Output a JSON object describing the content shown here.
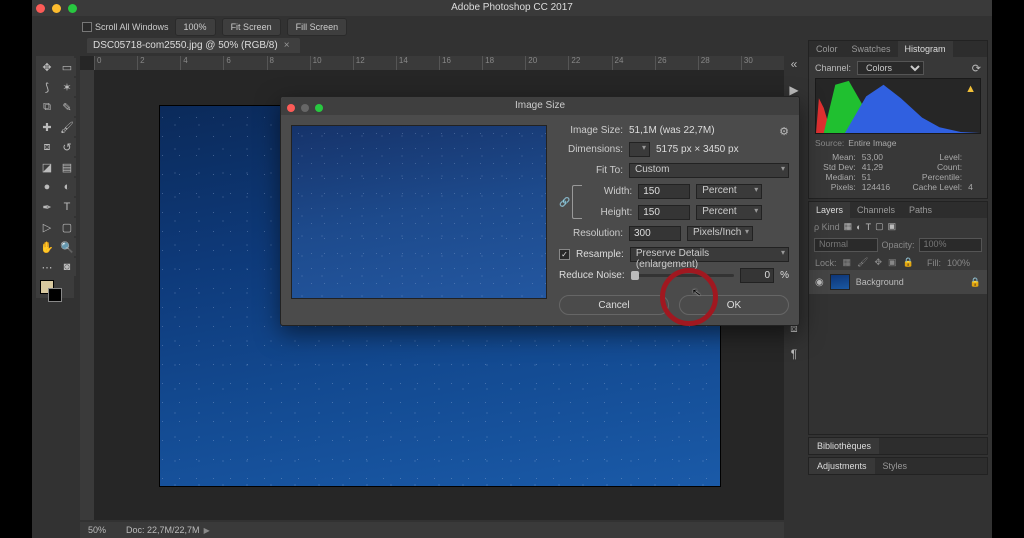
{
  "app": {
    "title": "Adobe Photoshop CC 2017"
  },
  "optionsbar": {
    "scroll_all": "Scroll All Windows",
    "zoom": "100%",
    "fitscreen": "Fit Screen",
    "fillscreen": "Fill Screen"
  },
  "doc_tab": {
    "label": "DSC05718-com2550.jpg @ 50% (RGB/8)"
  },
  "ruler_marks": [
    "0",
    "2",
    "4",
    "6",
    "8",
    "10",
    "12",
    "14",
    "16",
    "18",
    "20",
    "22",
    "24",
    "26",
    "28",
    "30"
  ],
  "statusbar": {
    "zoom": "50%",
    "docinfo": "Doc: 22,7M/22,7M"
  },
  "histogram_panel": {
    "tab_color": "Color",
    "tab_swatches": "Swatches",
    "tab_histogram": "Histogram",
    "channel_label": "Channel:",
    "channel_value": "Colors",
    "source_label": "Source:",
    "source_value": "Entire Image",
    "stats": {
      "mean_label": "Mean:",
      "mean": "53,00",
      "stddev_label": "Std Dev:",
      "stddev": "41,29",
      "median_label": "Median:",
      "median": "51",
      "pixels_label": "Pixels:",
      "pixels": "124416",
      "level_label": "Level:",
      "count_label": "Count:",
      "percentile_label": "Percentile:",
      "cache_label": "Cache Level:",
      "cache": "4"
    }
  },
  "layers_panel": {
    "tab_layers": "Layers",
    "tab_channels": "Channels",
    "tab_paths": "Paths",
    "kind_label": "ρ Kind",
    "blend_mode": "Normal",
    "opacity_label": "Opacity:",
    "opacity_value": "100%",
    "lock_label": "Lock:",
    "fill_label": "Fill:",
    "fill_value": "100%",
    "layer_name": "Background"
  },
  "biblio_panel": {
    "tab": "Bibliothèques"
  },
  "adj_panel": {
    "tab_adj": "Adjustments",
    "tab_styles": "Styles"
  },
  "dialog": {
    "title": "Image Size",
    "imagesize_label": "Image Size:",
    "imagesize_value": "51,1M (was 22,7M)",
    "dimensions_label": "Dimensions:",
    "dimensions_value": "5175 px × 3450 px",
    "fitto_label": "Fit To:",
    "fitto_value": "Custom",
    "width_label": "Width:",
    "width_value": "150",
    "width_unit": "Percent",
    "height_label": "Height:",
    "height_value": "150",
    "height_unit": "Percent",
    "resolution_label": "Resolution:",
    "resolution_value": "300",
    "resolution_unit": "Pixels/Inch",
    "resample_label": "Resample:",
    "resample_value": "Preserve Details (enlargement)",
    "reducenoise_label": "Reduce Noise:",
    "reducenoise_value": "0",
    "reducenoise_unit": "%",
    "cancel": "Cancel",
    "ok": "OK"
  }
}
